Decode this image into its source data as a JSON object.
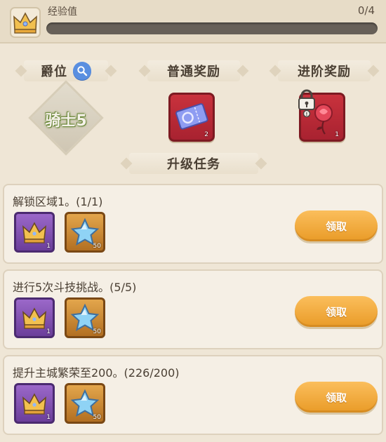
{
  "exp": {
    "label": "经验值",
    "value_text": "0/4",
    "progress": 0
  },
  "headers": {
    "rank": "爵位",
    "normal_reward": "普通奖励",
    "advanced_reward": "进阶奖励",
    "upgrade_tasks": "升级任务"
  },
  "rank": {
    "name": "骑士5"
  },
  "rewards": {
    "normal": {
      "icon": "ticket-icon",
      "count": "2"
    },
    "advanced": {
      "icon": "rose-icon",
      "count": "1",
      "locked": true
    }
  },
  "tasks": [
    {
      "title": "解锁区域1。(1/1)",
      "items": [
        {
          "icon": "crown-icon",
          "count": "1"
        },
        {
          "icon": "star-icon",
          "count": "50"
        }
      ],
      "button": "领取"
    },
    {
      "title": "进行5次斗技挑战。(5/5)",
      "items": [
        {
          "icon": "crown-icon",
          "count": "1"
        },
        {
          "icon": "star-icon",
          "count": "50"
        }
      ],
      "button": "领取"
    },
    {
      "title": "提升主城繁荣至200。(226/200)",
      "items": [
        {
          "icon": "crown-icon",
          "count": "1"
        },
        {
          "icon": "star-icon",
          "count": "50"
        }
      ],
      "button": "领取"
    }
  ],
  "colors": {
    "background": "#efe6d6",
    "claim_button": "#f4ad3d",
    "rank_text_outline": "#6d8a3d",
    "reward_card": "#c02d3a"
  }
}
